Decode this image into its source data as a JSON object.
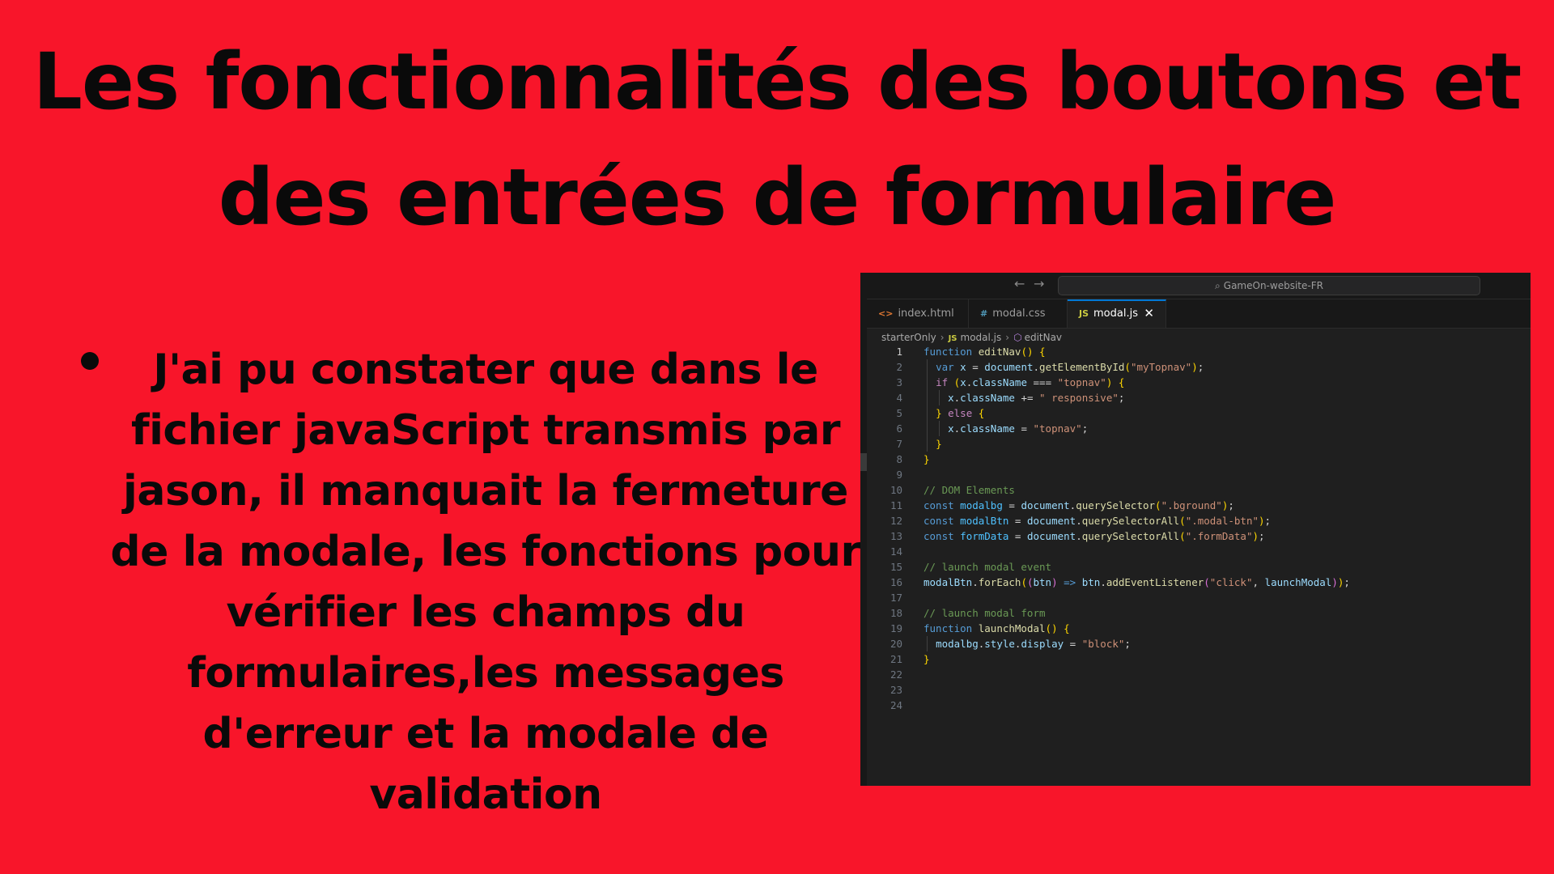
{
  "slide": {
    "title_line1": "Les fonctionnalités des boutons et",
    "title_line2": "des entrées de formulaire",
    "bullet_text": "J'ai pu constater que dans le fichier javaScript transmis par jason, il manquait la fermeture de la modale, les fonctions pour vérifier les champs du formulaires,les messages d'erreur et la modale de validation"
  },
  "editor": {
    "search_text": "GameOn-website-FR",
    "tabs": [
      {
        "icon": "<>",
        "label": "index.html"
      },
      {
        "icon": "#",
        "label": "modal.css"
      },
      {
        "icon": "JS",
        "label": "modal.js",
        "close": "✕"
      }
    ],
    "breadcrumb": {
      "folder": "starterOnly",
      "file_icon": "JS",
      "file": "modal.js",
      "symbol": "editNav"
    },
    "code_lines": [
      "function editNav() {",
      "  var x = document.getElementById(\"myTopnav\");",
      "  if (x.className === \"topnav\") {",
      "    x.className += \" responsive\";",
      "  } else {",
      "    x.className = \"topnav\";",
      "  }",
      "}",
      "",
      "// DOM Elements",
      "const modalbg = document.querySelector(\".bground\");",
      "const modalBtn = document.querySelectorAll(\".modal-btn\");",
      "const formData = document.querySelectorAll(\".formData\");",
      "",
      "// launch modal event",
      "modalBtn.forEach((btn) => btn.addEventListener(\"click\", launchModal));",
      "",
      "// launch modal form",
      "function launchModal() {",
      "  modalbg.style.display = \"block\";",
      "}",
      "",
      "",
      ""
    ],
    "line_numbers": [
      "1",
      "2",
      "3",
      "4",
      "5",
      "6",
      "7",
      "8",
      "9",
      "10",
      "11",
      "12",
      "13",
      "14",
      "15",
      "16",
      "17",
      "18",
      "19",
      "20",
      "21",
      "22",
      "23",
      "24"
    ]
  },
  "colors": {
    "background": "#f8152a",
    "title_text": "#0a0a0a",
    "editor_bg": "#1f1f1f",
    "accent": "#0078d4"
  },
  "icons": {
    "back": "arrow-left-icon",
    "forward": "arrow-right-icon",
    "search": "search-icon",
    "html_tab": "html-file-icon",
    "css_tab": "css-file-icon",
    "js_tab": "js-file-icon",
    "close": "close-icon",
    "symbol": "function-symbol-icon"
  }
}
